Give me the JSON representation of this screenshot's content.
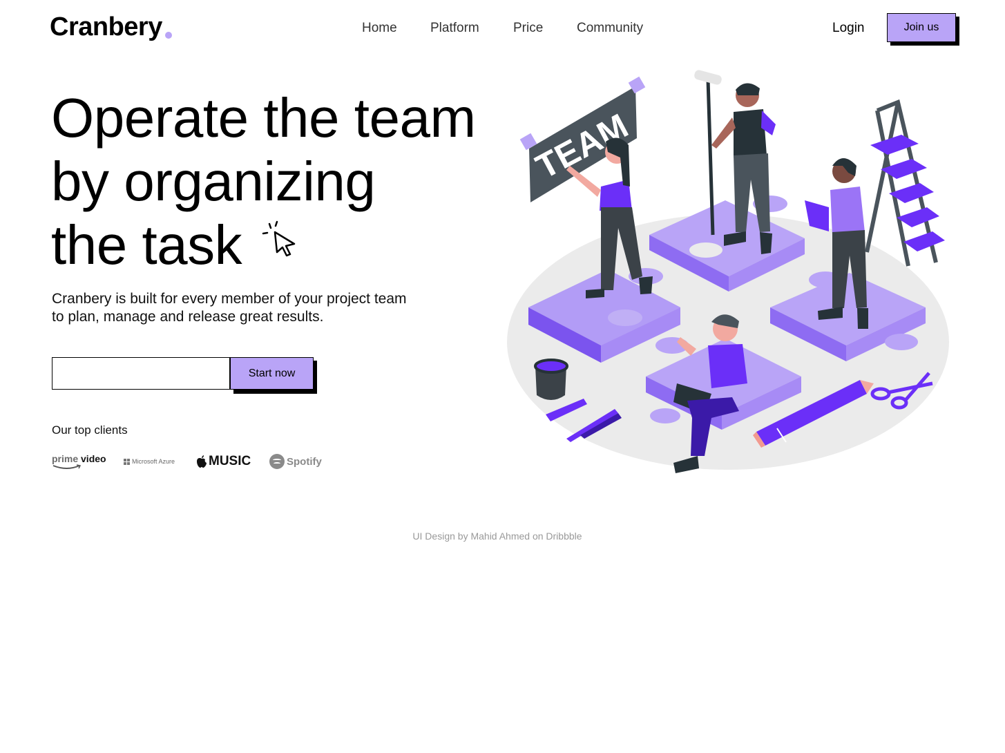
{
  "brand": {
    "name": "Cranbery",
    "accent": "#b9a4f7",
    "accent_dark": "#6b2ff8"
  },
  "nav": {
    "items": [
      {
        "label": "Home"
      },
      {
        "label": "Platform"
      },
      {
        "label": "Price"
      },
      {
        "label": "Community"
      }
    ],
    "login": "Login",
    "join": "Join us"
  },
  "hero": {
    "headline": [
      "Operate the team",
      "by organizing",
      "the task"
    ],
    "subtitle": [
      "Cranbery is built for every member of your project team",
      "to plan, manage and release great results."
    ],
    "email_value": "",
    "cta": "Start now",
    "illustration_sign": "TEAM",
    "cursor_icon": "pointer-click-icon"
  },
  "clients": {
    "label": "Our top clients",
    "logos": [
      {
        "name": "prime video",
        "text1": "prime",
        "text2": "video"
      },
      {
        "name": "Microsoft Azure",
        "text": "Microsoft Azure"
      },
      {
        "name": "Apple Music",
        "text": "MUSIC"
      },
      {
        "name": "Spotify",
        "text": "Spotify"
      }
    ]
  },
  "footer": {
    "credit": "UI Design by Mahid Ahmed on Dribbble"
  }
}
